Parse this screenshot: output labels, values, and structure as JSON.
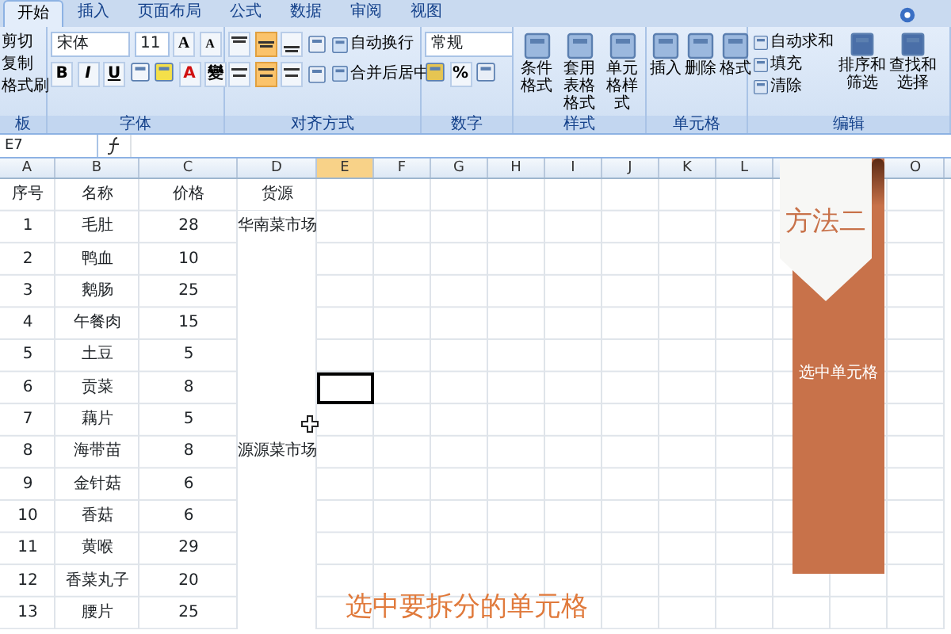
{
  "tabs": [
    {
      "label": "开始",
      "selected": true
    },
    {
      "label": "插入",
      "selected": false
    },
    {
      "label": "页面布局",
      "selected": false
    },
    {
      "label": "公式",
      "selected": false
    },
    {
      "label": "数据",
      "selected": false
    },
    {
      "label": "审阅",
      "selected": false
    },
    {
      "label": "视图",
      "selected": false
    }
  ],
  "ribbon": [
    {
      "kind": "clipboard",
      "label": "板",
      "items": [
        {
          "label": "剪切"
        },
        {
          "label": "复制"
        },
        {
          "label": "格式刷"
        }
      ]
    },
    {
      "kind": "font",
      "label": "字体",
      "font_name": "宋体",
      "font_size": "11",
      "size_buttons": [
        "A",
        "A"
      ],
      "style_buttons": [
        "B",
        "I",
        "U"
      ],
      "color_button": "A",
      "phonetic_button": "變"
    },
    {
      "kind": "alignment",
      "label": "对齐方式",
      "vertical": [
        {
          "on": false
        },
        {
          "on": true
        },
        {
          "on": false
        }
      ],
      "horizontal": [
        {
          "on": false
        },
        {
          "on": true
        },
        {
          "on": false
        }
      ],
      "wrap": "自动换行",
      "merge": "合并后居中"
    },
    {
      "kind": "number",
      "label": "数字",
      "format": "常规",
      "percent": "%"
    },
    {
      "kind": "big",
      "label": "样式",
      "items": [
        {
          "label": "条件格式"
        },
        {
          "label": "套用表格格式"
        },
        {
          "label": "单元格样式"
        }
      ]
    },
    {
      "kind": "big",
      "label": "单元格",
      "items": [
        {
          "label": "插入"
        },
        {
          "label": "删除"
        },
        {
          "label": "格式"
        }
      ]
    },
    {
      "kind": "editing",
      "label": "编辑",
      "items": [
        {
          "label": "自动求和"
        },
        {
          "label": "填充"
        },
        {
          "label": "清除"
        }
      ],
      "sort": "排序和筛选",
      "find": "查找和选择"
    }
  ],
  "formula_bar": {
    "name_box": "E7"
  },
  "columns": [
    {
      "kind": "header",
      "label": "A",
      "selected": false
    },
    {
      "kind": "header",
      "label": "B",
      "selected": false
    },
    {
      "kind": "header",
      "label": "C",
      "selected": false
    },
    {
      "kind": "header",
      "label": "D",
      "selected": false
    },
    {
      "kind": "header",
      "label": "E",
      "selected": true
    },
    {
      "kind": "header",
      "label": "F",
      "selected": false
    },
    {
      "kind": "header",
      "label": "G",
      "selected": false
    },
    {
      "kind": "header",
      "label": "H",
      "selected": false
    },
    {
      "kind": "header",
      "label": "I",
      "selected": false
    },
    {
      "kind": "header",
      "label": "J",
      "selected": false
    },
    {
      "kind": "header",
      "label": "K",
      "selected": false
    },
    {
      "kind": "header",
      "label": "L",
      "selected": false
    },
    {
      "kind": "covered"
    },
    {
      "kind": "covered"
    },
    {
      "kind": "header",
      "label": "O",
      "selected": false
    }
  ],
  "rows": [
    {
      "no": "序号",
      "name": "名称",
      "price": "价格",
      "source": "货源",
      "selected": false
    },
    {
      "no": "1",
      "name": "毛肚",
      "price": "28",
      "source": "华南菜市场",
      "selected": false
    },
    {
      "no": "2",
      "name": "鸭血",
      "price": "10",
      "selected": false
    },
    {
      "no": "3",
      "name": "鹅肠",
      "price": "25",
      "selected": false
    },
    {
      "no": "4",
      "name": "午餐肉",
      "price": "15",
      "selected": false
    },
    {
      "no": "5",
      "name": "土豆",
      "price": "5",
      "selected": false
    },
    {
      "no": "6",
      "name": "贡菜",
      "price": "8",
      "selected": true
    },
    {
      "no": "7",
      "name": "藕片",
      "price": "5",
      "selected": false
    },
    {
      "no": "8",
      "name": "海带苗",
      "price": "8",
      "source": "源源菜市场",
      "selected": false
    },
    {
      "no": "9",
      "name": "金针菇",
      "price": "6",
      "selected": false
    },
    {
      "no": "10",
      "name": "香菇",
      "price": "6",
      "selected": false
    },
    {
      "no": "11",
      "name": "黄喉",
      "price": "29",
      "selected": false
    },
    {
      "no": "12",
      "name": "香菜丸子",
      "price": "20",
      "selected": false
    },
    {
      "no": "13",
      "name": "腰片",
      "price": "25",
      "selected": false
    }
  ],
  "banner": {
    "title": "方法二",
    "text": "选中单元格"
  },
  "caption": "选中要拆分的单元格"
}
